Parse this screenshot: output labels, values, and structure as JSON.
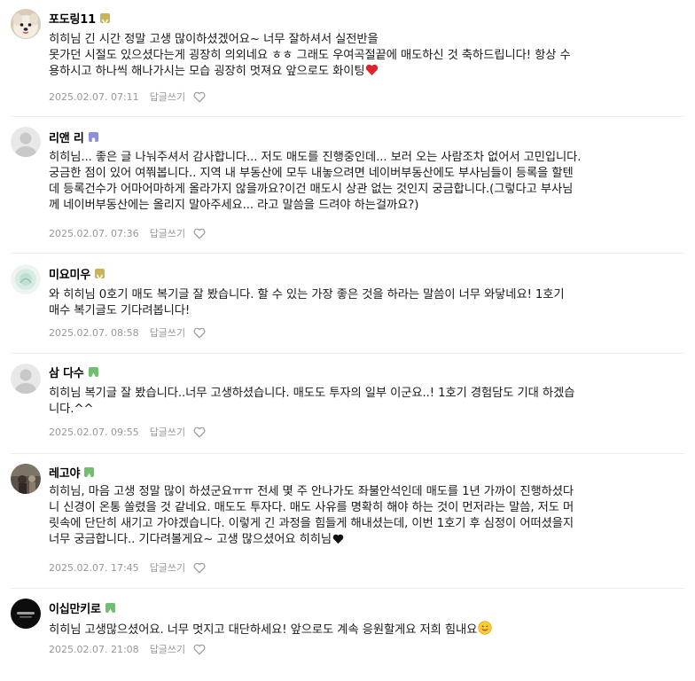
{
  "comments": [
    {
      "author": "포도링11",
      "badge_color": "#c9b45a",
      "avatar": "dog-photo",
      "lines": [
        "히히님 긴 시간 정말 고생 많이하셨겠어요~ 너무 잘하셔서 실전반을",
        "못가던 시절도 있으셨다는게 굉장히 의외네요 ㅎㅎ 그래도 우여곡절끝에 매도하신 것 축하드립니다! 항상 수",
        "용하시고 하나씩 해나가시는 모습 굉장히 멋져요 앞으로도 화이팅"
      ],
      "trailing_emoji": "red-heart",
      "date": "2025.02.07. 07:11",
      "reply_label": "답글쓰기"
    },
    {
      "author": "리앤 리",
      "badge_color": "#8f8fe0",
      "avatar": "default-profile",
      "lines": [
        "히히님... 좋은 글 나눠주셔서 감사합니다... 저도 매도를 진행중인데... 보러 오는 사람조차 없어서 고민입니다.",
        "궁금한 점이 있어 여쭤봅니다.. 지역 내 부동산에 모두 내놓으려면 네이버부동산에도 부사님들이 등록을 할텐",
        "데 등록건수가 어마어마하게 올라가지 않을까요?이건 매도시 상관 없는 것인지 궁금합니다.(그렇다고 부사님",
        "께 네이버부동산에는 올리지 말아주세요... 라고 말씀을 드려야 하는걸까요?)"
      ],
      "trailing_emoji": "",
      "date": "2025.02.07. 07:36",
      "reply_label": "답글쓰기"
    },
    {
      "author": "미요미우",
      "badge_color": "#c9b45a",
      "avatar": "mint-profile",
      "lines": [
        "와 히히님 0호기 매도 복기글 잘 봤습니다. 할 수 있는 가장 좋은 것을 하라는 말씀이 너무 와닿네요! 1호기",
        "매수 복기글도 기다려봅니다!"
      ],
      "trailing_emoji": "",
      "date": "2025.02.07. 08:58",
      "reply_label": "답글쓰기"
    },
    {
      "author": "삼 다수",
      "badge_color": "#6fbf6f",
      "avatar": "default-profile",
      "lines": [
        "히히님 복기글 잘 봤습니다..너무 고생하셨습니다. 매도도 투자의 일부 이군요..! 1호기 경험담도 기대 하겠습",
        "니다.^^"
      ],
      "trailing_emoji": "",
      "date": "2025.02.07. 09:55",
      "reply_label": "답글쓰기"
    },
    {
      "author": "레고야",
      "badge_color": "#6fbf6f",
      "avatar": "dark-photo",
      "lines": [
        "히히님, 마음 고생 정말 많이 하셨군요ㅠㅠ 전세 몇 주 안나가도 좌불안석인데 매도를 1년 가까이 진행하셨다",
        "니 신경이 온통 쏠렸을 것 같네요. 매도도 투자다. 매도 사유를 명확히 해야 하는 것이 먼저라는 말씀, 저도 머",
        "릿속에 단단히 새기고 가야겠습니다. 이렇게 긴 과정을 힘들게 해내셨는데, 이번 1호기 후 심정이 어떠셨을지",
        "너무 궁금합니다.. 기다려볼게요~ 고생 많으셨어요 히히님"
      ],
      "trailing_emoji": "black-heart",
      "date": "2025.02.07. 17:45",
      "reply_label": "답글쓰기"
    },
    {
      "author": "이십만키로",
      "badge_color": "#6fbf6f",
      "avatar": "black-logo",
      "lines": [
        "히히님 고생많으셨어요. 너무 멋지고 대단하세요! 앞으로도 계속 응원할게요 저희 힘내요"
      ],
      "trailing_emoji": "smile-face",
      "date": "2025.02.07. 21:08",
      "reply_label": "답글쓰기"
    }
  ]
}
